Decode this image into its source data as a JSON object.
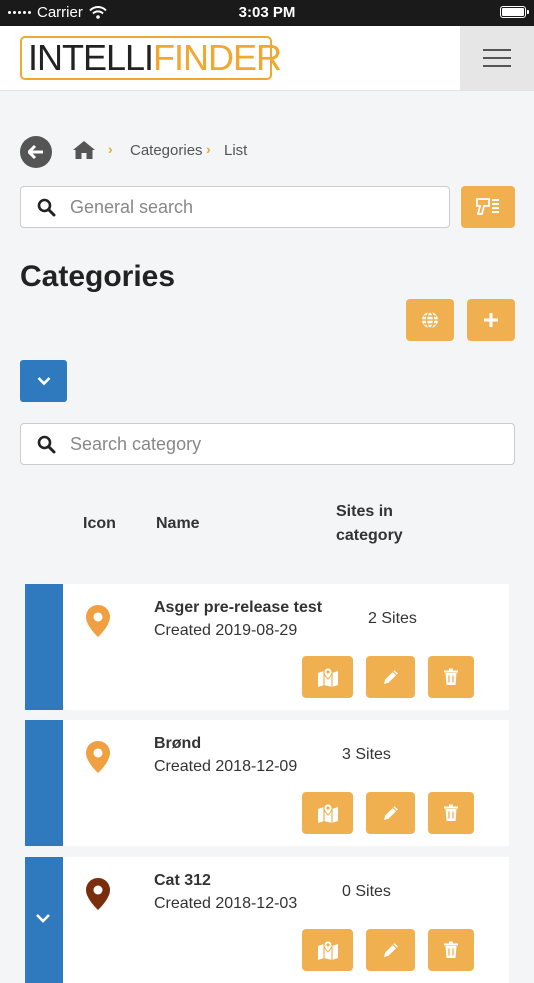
{
  "status_bar": {
    "carrier": "Carrier",
    "time": "3:03 PM"
  },
  "header": {
    "logo_part1": "INTELLI",
    "logo_part2": "FINDER",
    "menu_icon": "hamburger-icon"
  },
  "breadcrumb": {
    "items": [
      "Categories",
      "List"
    ],
    "home_icon": "home-icon",
    "back_icon": "back-arrow-icon"
  },
  "general_search": {
    "placeholder": "General search",
    "value": ""
  },
  "page_title": "Categories",
  "category_search": {
    "placeholder": "Search category",
    "value": ""
  },
  "table": {
    "col_icon": "Icon",
    "col_name": "Name",
    "col_sites_line1": "Sites in",
    "col_sites_line2": "category"
  },
  "categories": [
    {
      "name": "Asger pre-release test",
      "created": "Created 2019-08-29",
      "sites": "2 Sites",
      "pin_color": "#f0a040"
    },
    {
      "name": "Brønd",
      "created": "Created 2018-12-09",
      "sites": "3 Sites",
      "pin_color": "#f0a040"
    },
    {
      "name": "Cat 312",
      "created": "Created 2018-12-03",
      "sites": "0 Sites",
      "pin_color": "#7a2e0e"
    }
  ],
  "colors": {
    "accent": "#f0b050",
    "primary": "#2f79bf",
    "logo_orange": "#f0a830"
  }
}
